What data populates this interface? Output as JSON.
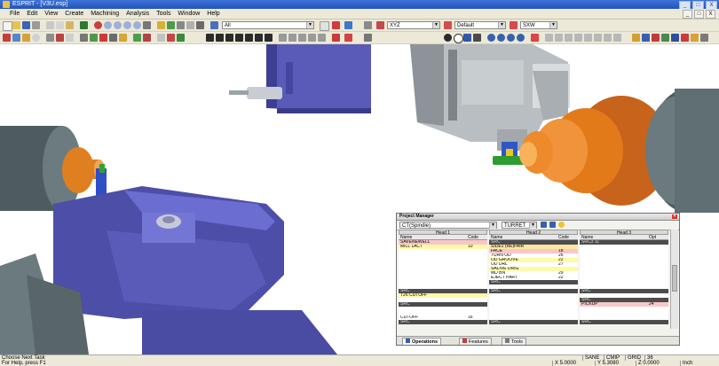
{
  "window": {
    "title": "ESPRIT - [V3U.esp]",
    "controls": [
      "_",
      "□",
      "X"
    ],
    "doc_controls": [
      "_",
      "□",
      "X"
    ]
  },
  "menu": [
    "File",
    "Edit",
    "View",
    "Create",
    "Machining",
    "Analysis",
    "Tools",
    "Window",
    "Help"
  ],
  "toolbar": {
    "layer_combo": "All",
    "plane_combo": "XYZ",
    "style_combo": "Default",
    "view_combo": "SXW"
  },
  "project_manager": {
    "title": "Project Manager",
    "combo1": "CT(Spindle)",
    "combo2": "TURRET",
    "heads": [
      "Head 1",
      "Head 2",
      "Head 3"
    ],
    "subheads": {
      "name": "Name",
      "code": "Code",
      "opt": "Opt"
    },
    "col1": [
      {
        "name": "SAVENEWELL",
        "code": "",
        "style": "r-p"
      },
      {
        "name": "MILL 1ACT",
        "code": "10",
        "style": "r-y"
      },
      {
        "name": "",
        "code": "",
        "style": "r-w"
      },
      {
        "name": "",
        "code": "",
        "style": "r-w"
      },
      {
        "name": "",
        "code": "",
        "style": "r-w"
      },
      {
        "name": "",
        "code": "",
        "style": "r-w"
      },
      {
        "name": "",
        "code": "",
        "style": "r-w"
      },
      {
        "name": "",
        "code": "",
        "style": "r-w"
      },
      {
        "name": "",
        "code": "",
        "style": "r-w"
      },
      {
        "name": "",
        "code": "",
        "style": "r-w"
      },
      {
        "name": "",
        "code": "",
        "style": "r-w"
      },
      {
        "name": "SRC",
        "code": "",
        "style": "r-g"
      },
      {
        "name": "T26 CUTOFF",
        "code": "",
        "style": "r-y"
      },
      {
        "name": "",
        "code": "",
        "style": "r-w"
      },
      {
        "name": "SRC",
        "code": "",
        "style": "r-g"
      },
      {
        "name": "",
        "code": "",
        "style": "r-w"
      },
      {
        "name": "",
        "code": "",
        "style": "r-w"
      },
      {
        "name": "CUTOFF",
        "code": "16",
        "style": "r-w"
      },
      {
        "name": "SRC",
        "code": "",
        "style": "r-g"
      }
    ],
    "col2": [
      {
        "name": "SRC",
        "code": "",
        "style": "r-g"
      },
      {
        "name": "SIDE1 (RE)FAIR",
        "code": "",
        "style": "r-l"
      },
      {
        "name": "FACE",
        "code": "18",
        "style": "r-p"
      },
      {
        "name": "TURN OD",
        "code": "26",
        "style": "r-w"
      },
      {
        "name": "OD GROOVE",
        "code": "22",
        "style": "r-y"
      },
      {
        "name": "OD DRL",
        "code": "27",
        "style": "r-w"
      },
      {
        "name": "SALIVE DRIG",
        "code": "",
        "style": "r-y"
      },
      {
        "name": "MD BN",
        "code": "29",
        "style": "r-w"
      },
      {
        "name": "EJECT PART",
        "code": "22",
        "style": "r-w"
      },
      {
        "name": "SRC",
        "code": "",
        "style": "r-g"
      },
      {
        "name": "",
        "code": "",
        "style": "r-w"
      },
      {
        "name": "SRC",
        "code": "",
        "style": "r-g"
      },
      {
        "name": "",
        "code": "",
        "style": "r-w"
      },
      {
        "name": "",
        "code": "",
        "style": "r-w"
      },
      {
        "name": "",
        "code": "",
        "style": "r-w"
      },
      {
        "name": "",
        "code": "",
        "style": "r-w"
      },
      {
        "name": "",
        "code": "",
        "style": "r-w"
      },
      {
        "name": "",
        "code": "",
        "style": "r-w"
      },
      {
        "name": "SRC",
        "code": "",
        "style": "r-g"
      }
    ],
    "col3": [
      {
        "name": "SRC3 11",
        "code": "",
        "style": "r-g"
      },
      {
        "name": "",
        "code": "",
        "style": "r-w"
      },
      {
        "name": "",
        "code": "",
        "style": "r-w"
      },
      {
        "name": "",
        "code": "",
        "style": "r-w"
      },
      {
        "name": "",
        "code": "",
        "style": "r-w"
      },
      {
        "name": "",
        "code": "",
        "style": "r-w"
      },
      {
        "name": "",
        "code": "",
        "style": "r-w"
      },
      {
        "name": "",
        "code": "",
        "style": "r-w"
      },
      {
        "name": "",
        "code": "",
        "style": "r-w"
      },
      {
        "name": "",
        "code": "",
        "style": "r-w"
      },
      {
        "name": "",
        "code": "",
        "style": "r-w"
      },
      {
        "name": "SRC",
        "code": "",
        "style": "r-g"
      },
      {
        "name": "",
        "code": "",
        "style": "r-w"
      },
      {
        "name": "SRC",
        "code": "",
        "style": "r-g"
      },
      {
        "name": "PICKUP",
        "code": "24",
        "style": "r-p"
      },
      {
        "name": "",
        "code": "",
        "style": "r-w"
      },
      {
        "name": "",
        "code": "",
        "style": "r-w"
      },
      {
        "name": "",
        "code": "",
        "style": "r-w"
      },
      {
        "name": "SRC",
        "code": "",
        "style": "r-g"
      }
    ],
    "tabs": [
      "Operations",
      "Features",
      "Tools"
    ]
  },
  "status": {
    "line1": "Choose Next Task",
    "line2": "For Help, press F1",
    "cells_top": [
      "SANE",
      "CMIP",
      "GRID",
      "36"
    ],
    "cells_bottom": [
      "X 5.0000",
      "Y 5.3080",
      "Z 0.0000",
      "Inch"
    ]
  },
  "colors": {
    "titlebar": "#2354b9",
    "chrome": "#ece9d8",
    "fixture_purple": "#5a5bb8",
    "chuck_orange": "#e27a1a",
    "spindle_gray": "#5f6f74"
  }
}
